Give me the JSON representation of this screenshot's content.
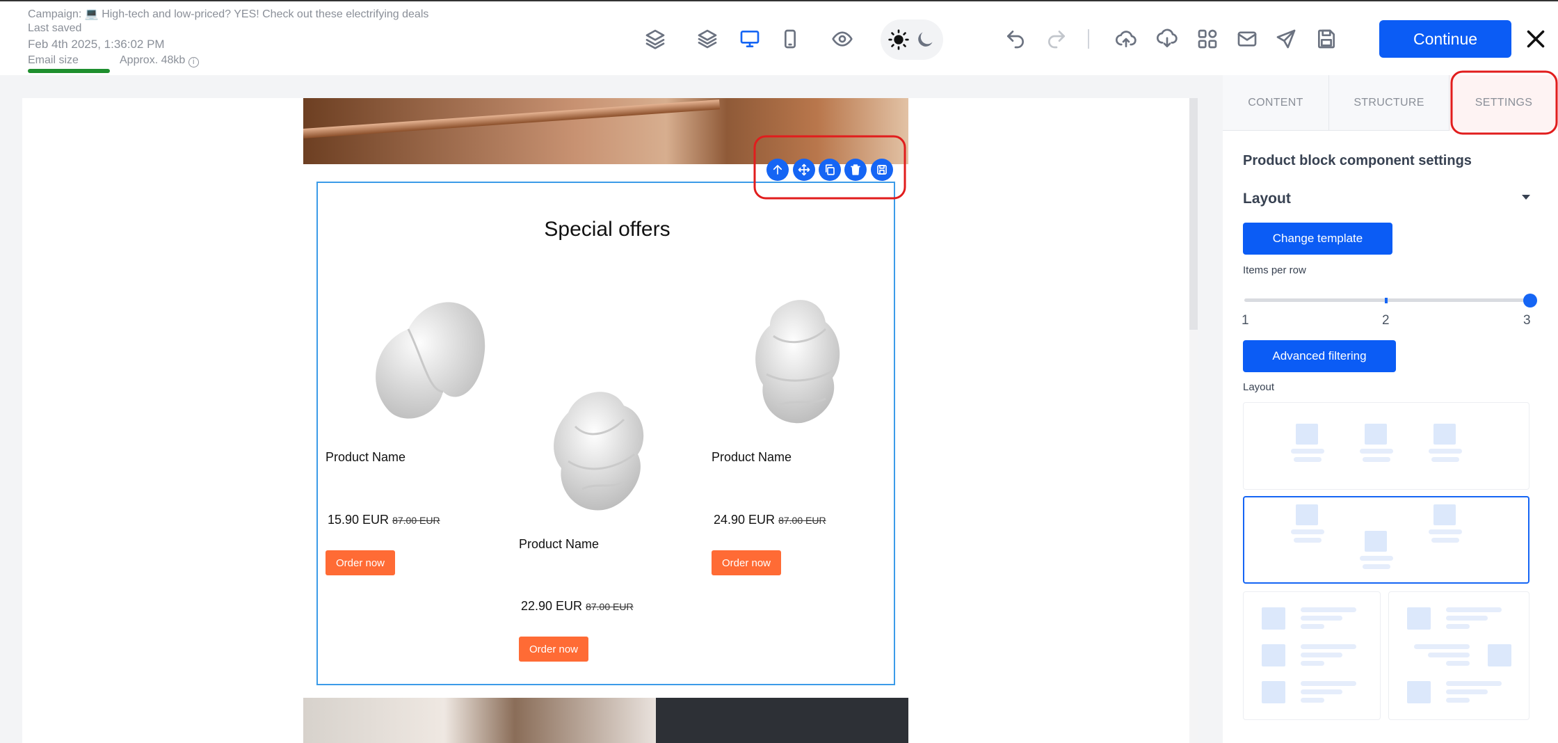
{
  "header": {
    "campaign": "Campaign: 💻 High-tech and low-priced? YES! Check out these electrifying deals",
    "last_saved_label": "Last saved",
    "last_saved_date": "Feb 4th 2025, 1:36:02 PM",
    "email_size_label": "Email size",
    "email_size_value": "Approx. 48kb",
    "continue_label": "Continue"
  },
  "email": {
    "block_title": "Special offers",
    "products": [
      {
        "name": "Product Name",
        "price": "15.90 EUR",
        "old_price": "87.00 EUR",
        "button": "Order now"
      },
      {
        "name": "Product Name",
        "price": "22.90 EUR",
        "old_price": "87.00 EUR",
        "button": "Order now"
      },
      {
        "name": "Product Name",
        "price": "24.90 EUR",
        "old_price": "87.00 EUR",
        "button": "Order now"
      }
    ]
  },
  "panel": {
    "tabs": [
      "CONTENT",
      "STRUCTURE",
      "SETTINGS"
    ],
    "active_tab": "SETTINGS",
    "title": "Product block component settings",
    "section": "Layout",
    "change_template": "Change template",
    "items_per_row_label": "Items per row",
    "items_per_row": {
      "min": "1",
      "mid": "2",
      "max": "3",
      "value": 3
    },
    "advanced_filtering": "Advanced filtering",
    "layout_label": "Layout"
  },
  "colors": {
    "accent": "#0b5cf5",
    "order_button": "#ff6b35",
    "highlight": "#e11d1d"
  }
}
